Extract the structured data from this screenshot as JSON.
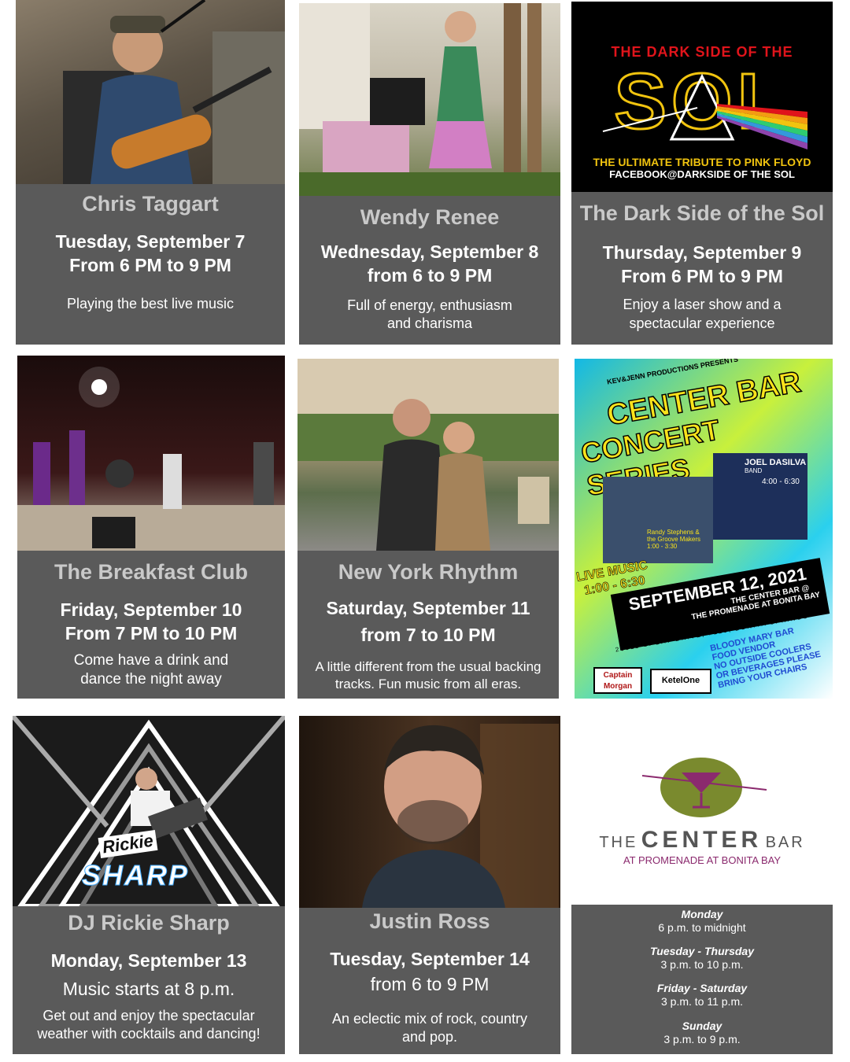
{
  "colors": {
    "panel": "#5a5a5a",
    "name": "#c9c9c9",
    "text": "#ffffff",
    "brand_green": "#7a8a2e",
    "brand_magenta": "#8b2a6e"
  },
  "cards": [
    {
      "name": "Chris Taggart",
      "date_line1": "Tuesday, September 7",
      "date_line2": "From 6 PM to 9 PM",
      "desc_line1": "Playing the best live music",
      "desc_line2": ""
    },
    {
      "name": "Wendy Renee",
      "date_line1": "Wednesday, September 8",
      "date_line2": "from 6 to 9 PM",
      "desc_line1": "Full of energy, enthusiasm",
      "desc_line2": "and charisma"
    },
    {
      "name": "The Dark Side of the Sol",
      "date_line1": "Thursday, September 9",
      "date_line2": "From 6 PM to 9 PM",
      "desc_line1": "Enjoy a laser show and a",
      "desc_line2": "spectacular experience"
    },
    {
      "name": "The Breakfast Club",
      "date_line1": "Friday, September 10",
      "date_line2": "From 7 PM to 10 PM",
      "desc_line1": "Come have a drink and",
      "desc_line2": "dance the night away"
    },
    {
      "name": "New York Rhythm",
      "date_line1": "Saturday, September 11",
      "date_line2": "from 7 to 10 PM",
      "desc_line1": "A little different from the usual backing",
      "desc_line2": "tracks. Fun music from all eras."
    },
    {
      "name": "DJ Rickie Sharp",
      "date_line1": "Monday, September 13",
      "date_line2": "Music starts at 8 p.m.",
      "desc_line1": "Get out and enjoy the spectacular",
      "desc_line2": "weather with cocktails and dancing!"
    },
    {
      "name": "Justin Ross",
      "date_line1": "Tuesday, September 14",
      "date_line2": "from 6 to 9 PM",
      "desc_line1": "An eclectic mix of rock, country",
      "desc_line2": "and pop."
    }
  ],
  "sol_poster": {
    "top": "THE DARK SIDE OF THE",
    "big": "SOL",
    "tag1": "THE ULTIMATE TRIBUTE TO PINK FLOYD",
    "tag2": "FACEBOOK@DARKSIDE OF THE SOL"
  },
  "concert_poster": {
    "presenter": "KEV&JENN PRODUCTIONS PRESENTS",
    "title1": "CENTER BAR",
    "title2": "CONCERT SERIES",
    "act1": "JOEL DASILVA",
    "act1_sub": "BAND",
    "act1_time": "4:00 - 6:30",
    "act2": "Randy Stephens & the Groove Makers 1:00 - 3:30",
    "live_music": "LIVE MUSIC",
    "live_time": "1:00 - 6:30",
    "date": "SEPTEMBER 12, 2021",
    "venue1": "THE CENTER BAR @",
    "venue2": "THE PROMENADE AT BONITA BAY",
    "address": "26811 S. BAY DRIVE, #128, BONITA SPRINGS",
    "notes": [
      "BLOODY MARY BAR",
      "FOOD VENDOR",
      "NO OUTSIDE COOLERS",
      "OR BEVERAGES PLEASE",
      "BRING YOUR CHAIRS"
    ],
    "sponsor1": "Captain Morgan",
    "sponsor2": "KetelOne"
  },
  "logo": {
    "the": "THE",
    "center": "CENTER",
    "bar": "BAR",
    "sub": "AT PROMENADE AT BONITA BAY"
  },
  "dj_logo": {
    "line1": "Rickie",
    "line2": "SHARP"
  },
  "hours": [
    {
      "day": "Monday",
      "time": "6 p.m. to midnight"
    },
    {
      "day": "Tuesday - Thursday",
      "time": "3 p.m. to 10 p.m."
    },
    {
      "day": "Friday - Saturday",
      "time": "3 p.m. to 11 p.m."
    },
    {
      "day": "Sunday",
      "time": "3 p.m. to 9 p.m."
    }
  ]
}
